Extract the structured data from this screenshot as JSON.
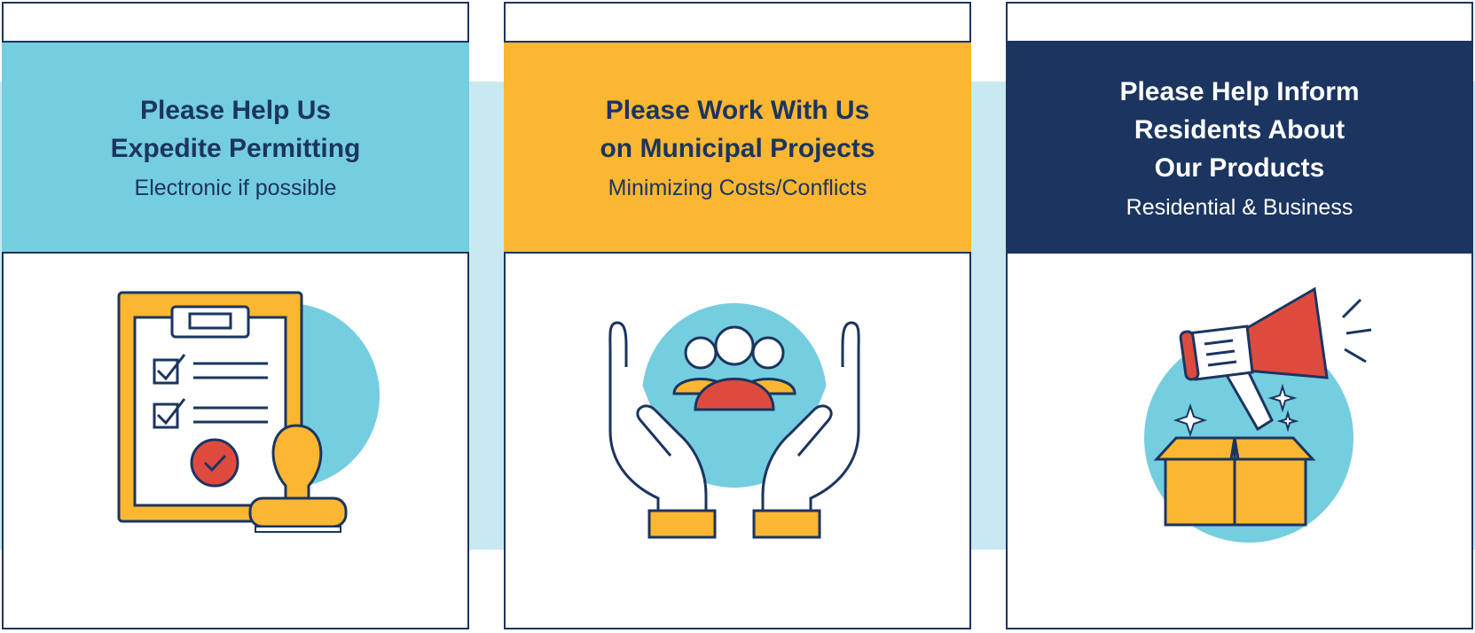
{
  "colors": {
    "navy": "#1b3560",
    "light_blue": "#75cde0",
    "band": "#c8e9f1",
    "amber": "#fbb632",
    "red": "#de4b3e",
    "white": "#ffffff"
  },
  "cards": [
    {
      "title_lines": [
        "Please Help Us",
        "Expedite Permitting"
      ],
      "subtitle": "Electronic if possible",
      "icon": "clipboard-stamp-icon"
    },
    {
      "title_lines": [
        "Please Work With Us",
        "on Municipal Projects"
      ],
      "subtitle": "Minimizing Costs/Conflicts",
      "icon": "hands-community-icon"
    },
    {
      "title_lines": [
        "Please Help Inform",
        "Residents About",
        "Our Products"
      ],
      "subtitle": "Residential & Business",
      "icon": "megaphone-box-icon"
    }
  ]
}
